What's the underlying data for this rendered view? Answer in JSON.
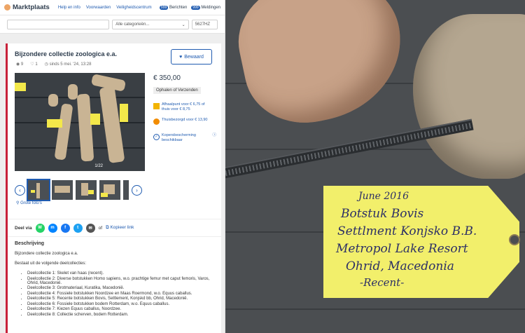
{
  "topbar": {
    "logo": "Marktplaats",
    "links": [
      "Help en info",
      "Voorwaarden",
      "Veiligheidscentrum"
    ],
    "berichten": "Berichten",
    "meldingen": "Meldingen",
    "berichten_count": "999",
    "meldingen_count": "999"
  },
  "search": {
    "category": "Alle categorieën...",
    "zip": "5627HZ"
  },
  "listing": {
    "title": "Bijzondere collectie zoologica e.a.",
    "views": "9",
    "favorites": "1",
    "since": "sinds 5 mei. '24, 13:28",
    "save_label": "Bewaard",
    "photo_counter": "1/22",
    "photos_link": "Grote foto's",
    "price": "€ 350,00",
    "shipping": "Ophalen of Verzenden",
    "options": [
      "Afhaalpunt voor € 6,75 of thuis voor € 8,75",
      "Thuisbezorgd voor € 13,90",
      "Kopersbescherming beschikbaar"
    ],
    "share_label": "Deel via",
    "share_of": "of",
    "copy_link": "Kopieer link"
  },
  "description": {
    "heading": "Beschrijving",
    "intro": "Bijzondere collectie zoologica e.a.",
    "sub": "Bestaat uit de volgende deelcollecties:",
    "items": [
      "Deelcollectie 1: Skelet van haas (recent).",
      "Deelcollectie 2: Diverse botstukken Homo sapiens, w.o. prachtige femur met caput femoris, Varos, Ohrid, Macedonië.",
      "Deelcollectie 3: Grotmateriaal, Kuratika, Macedonië.",
      "Deelcollectie 4: Fossiele botstukken Noordzee en Maas Roermond, w.o. Equus caballus.",
      "Deelcollectie 5: Recente botstukken Bovis, Settlement, Konjskd bb, Ohrid, Macedonië.",
      "Deelcollectie 6: Fossiele botstukken bodem Rotterdam, w.o. Equus caballus.",
      "Deelcollectie 7: Kiezen Equus caballus, Noordzee.",
      "Deelcollectie 8: Collectie scherven, bodem Rotterdam."
    ]
  },
  "photo_tag": {
    "lines": [
      "June 2016",
      "Botstuk Bovis",
      "Settlment Konjsko B.B.",
      "Metropol Lake Resort",
      "Ohrid, Macedonia",
      "-Recent-"
    ]
  },
  "colors": {
    "brand_blue": "#1f5bb0",
    "accent_red": "#c8223a",
    "tag_yellow": "#f2ef6b"
  }
}
